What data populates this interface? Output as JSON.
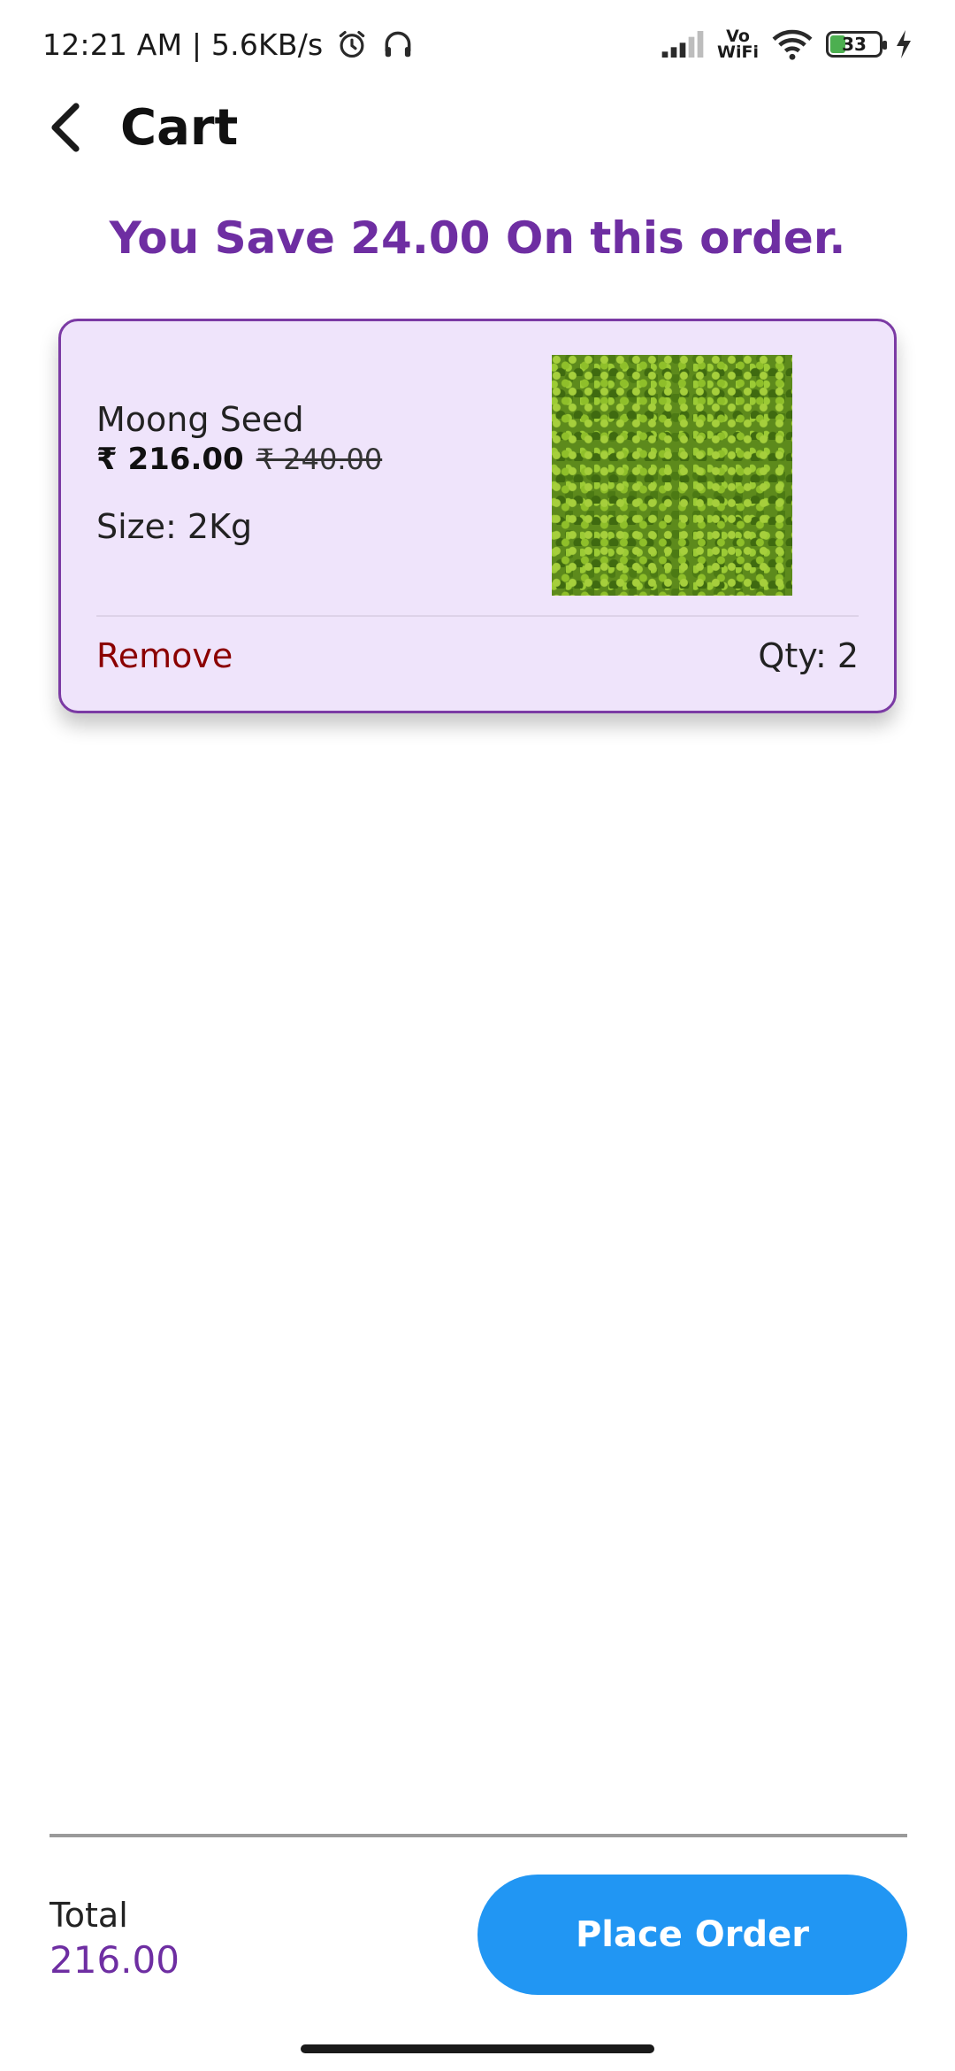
{
  "status_bar": {
    "time": "12:21 AM | 5.6KB/s",
    "vowifi_top": "Vo",
    "vowifi_bottom": "WiFi",
    "battery_level": "33",
    "icons": [
      "alarm-icon",
      "headphones-icon",
      "signal-icon",
      "wifi-icon",
      "battery-icon",
      "charging-icon"
    ]
  },
  "app_bar": {
    "title": "Cart",
    "back_icon": "chevron-left-icon"
  },
  "savings_banner": "You Save 24.00 On this order.",
  "cart": {
    "items": [
      {
        "name": "Moong Seed",
        "price": "₹ 216.00",
        "original_price": "₹ 240.00",
        "size": "Size: 2Kg",
        "remove_label": "Remove",
        "quantity": "Qty: 2"
      }
    ]
  },
  "footer": {
    "total_label": "Total",
    "total_value": "216.00",
    "place_order_label": "Place Order"
  },
  "colors": {
    "accent_purple": "#6e2ea2",
    "card_background": "#efe4fb",
    "remove_red": "#8b0000",
    "button_blue": "#2196f3"
  }
}
